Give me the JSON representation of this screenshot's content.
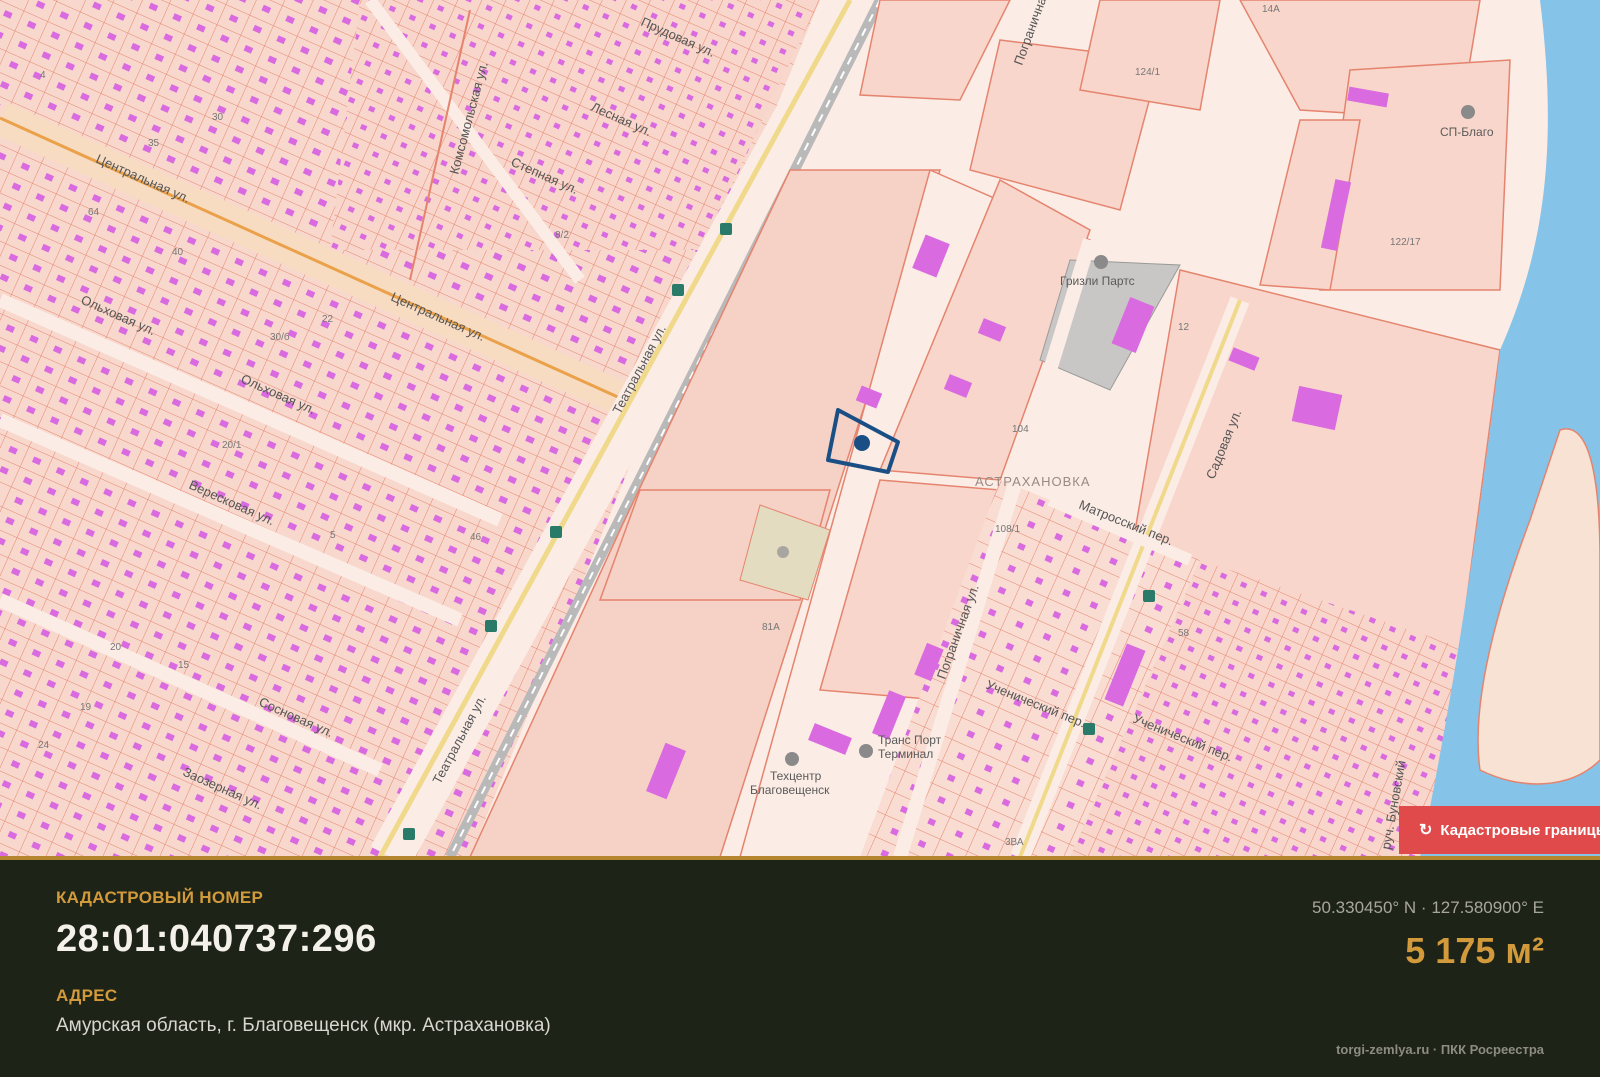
{
  "map": {
    "streets": {
      "tsentralnaya_1": "Центральная ул.",
      "tsentralnaya_2": "Центральная ул.",
      "teatralnaya_1": "Театральная ул.",
      "teatralnaya_2": "Театральная ул.",
      "olkhovaya": "Ольховая ул.",
      "olkhovaya_2": "Ольховая ул.",
      "verkhovaya": "Вересковая ул.",
      "sosnovaya": "Сосновая ул.",
      "zaozernaya": "Заозерная ул.",
      "pogranichnaya_1": "Пограничная",
      "pogranichnaya_2": "Пограничная ул.",
      "matrossky": "Матросский пер.",
      "sadovaya": "Садовая ул.",
      "lesnaya": "Лесная ул.",
      "stepnaya": "Степная ул.",
      "prudovaya": "Прудовая ул.",
      "komsomolskaya": "Комсомольская ул.",
      "uchenichesky_1": "Ученический пер.",
      "uchenichesky_2": "Ученический пер.",
      "ruch_bunovsky": "руч. Буновский"
    },
    "district": "АСТРАХАНОВКА",
    "pois": {
      "sp_blago": "СП-Благо",
      "grizli": "Гризли Партс",
      "trans_port_1": "Транс Порт",
      "trans_port_2": "Терминал",
      "technics_1": "Техцентр",
      "technics_2": "Благовещенск"
    },
    "plot_numbers": [
      "124/1",
      "122/17",
      "104",
      "81А",
      "3ВА",
      "58",
      "35",
      "64",
      "40",
      "22",
      "30/б",
      "15",
      "20/1",
      "20",
      "19",
      "24",
      "14А",
      "108/1",
      "12",
      "46",
      "30",
      "5",
      "8/2",
      "4"
    ],
    "layer_button": "Кадастровые границы",
    "colors": {
      "parcel_border": "#e5846e",
      "parcel_fill": "#f8d6cb",
      "building": "#d96ae0",
      "road_yellow": "#f0d98a",
      "river": "#86c3e8",
      "selected": "#1a4f86"
    }
  },
  "info": {
    "cad_label": "КАДАСТРОВЫЙ НОМЕР",
    "cad_number": "28:01:040737:296",
    "addr_label": "АДРЕС",
    "address": "Амурская область, г. Благовещенск (мкр. Астрахановка)",
    "coords": "50.330450° N · 127.580900° E",
    "area": "5 175 м²",
    "source": "torgi-zemlya.ru · ПКК Росреестра"
  }
}
